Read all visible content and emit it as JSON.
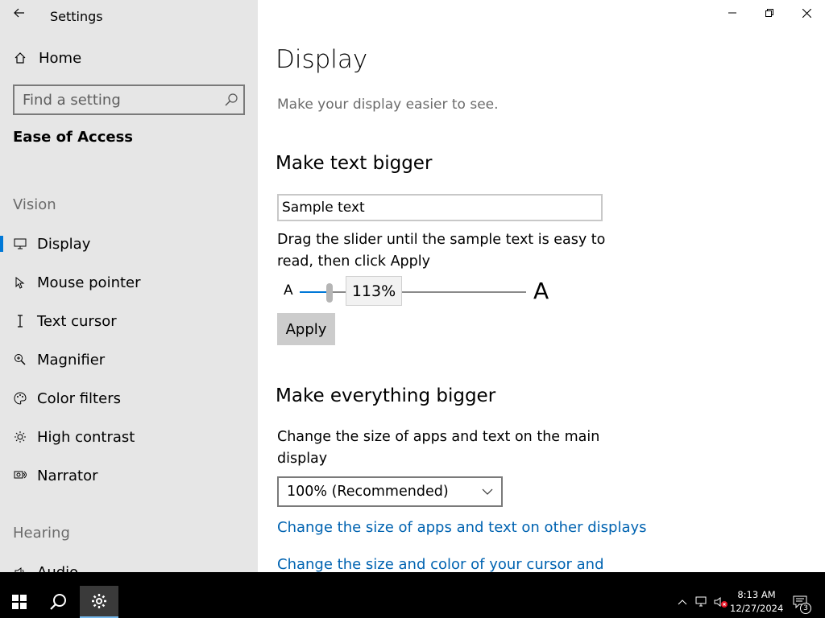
{
  "window": {
    "title": "Settings",
    "controls": [
      "minimize-icon",
      "restore-icon",
      "close-icon"
    ]
  },
  "sidebar": {
    "home_label": "Home",
    "search_placeholder": "Find a setting",
    "section_title": "Ease of Access",
    "groups": [
      {
        "label": "Vision",
        "items": [
          {
            "label": "Display",
            "icon": "monitor-icon",
            "active": true
          },
          {
            "label": "Mouse pointer",
            "icon": "mouse-pointer-icon"
          },
          {
            "label": "Text cursor",
            "icon": "text-cursor-icon"
          },
          {
            "label": "Magnifier",
            "icon": "magnifier-icon"
          },
          {
            "label": "Color filters",
            "icon": "color-filters-icon"
          },
          {
            "label": "High contrast",
            "icon": "high-contrast-icon"
          },
          {
            "label": "Narrator",
            "icon": "narrator-icon"
          }
        ]
      },
      {
        "label": "Hearing",
        "items": [
          {
            "label": "Audio",
            "icon": "audio-icon"
          }
        ]
      }
    ]
  },
  "main": {
    "title": "Display",
    "subtitle": "Make your display easier to see.",
    "text_section": {
      "heading": "Make text bigger",
      "sample_text": "Sample text",
      "description": "Drag the slider until the sample text is easy to read, then click Apply",
      "slider_min_label": "A",
      "slider_max_label": "A",
      "slider_value": "113%",
      "slider_fraction": 0.13,
      "apply_label": "Apply"
    },
    "everything_section": {
      "heading": "Make everything bigger",
      "description": "Change the size of apps and text on the main display",
      "dropdown_value": "100% (Recommended)",
      "links": [
        "Change the size of apps and text on other displays",
        "Change the size and color of your cursor and"
      ]
    }
  },
  "taskbar": {
    "time": "8:13 AM",
    "date": "12/27/2024",
    "notification_count": "3",
    "buttons": [
      "windows-start-icon",
      "search-icon",
      "settings-gear-icon"
    ],
    "tray": [
      "chevron-up-icon",
      "network-icon",
      "volume-muted-icon",
      "action-center-icon"
    ]
  },
  "colors": {
    "accent": "#0078d7",
    "link": "#0063b1",
    "sidebar_bg": "#e6e6e6"
  }
}
